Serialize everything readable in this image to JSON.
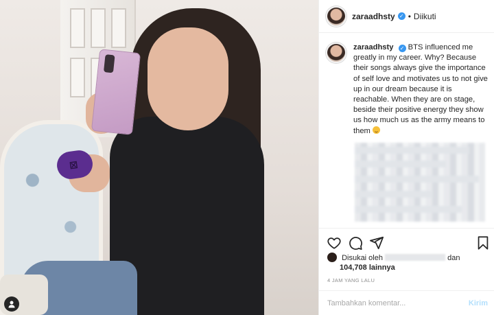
{
  "post": {
    "username": "zaraadhsty",
    "follow_status": "Diikuti",
    "separator": "•",
    "verified_glyph": "✓"
  },
  "caption": {
    "username": "zaraadhsty",
    "text": "BTS influenced me greatly in my career. Why? Because their songs always give the importance of self love and motivates us to not give up in our dream because it is reachable. When they are on stage, beside their positive energy they show us how much us as the army means to them",
    "emoji": "smiling-face-emoji"
  },
  "likes": {
    "prefix": "Disukai oleh",
    "suffix": "dan",
    "count": "104,708",
    "count_suffix": "lainnya"
  },
  "timestamp": "4 JAM YANG LALU",
  "comment": {
    "placeholder": "Tambahkan komentar...",
    "send_label": "Kirim"
  },
  "icons": {
    "like": "heart-icon",
    "comment": "comment-icon",
    "share": "share-icon",
    "save": "bookmark-icon",
    "tag": "user-tag-icon"
  },
  "colors": {
    "verified": "#3897f0",
    "send_disabled": "#b2dffc",
    "meta_text": "#8e8e8e"
  },
  "photo": {
    "buds_logo": "⊠"
  }
}
